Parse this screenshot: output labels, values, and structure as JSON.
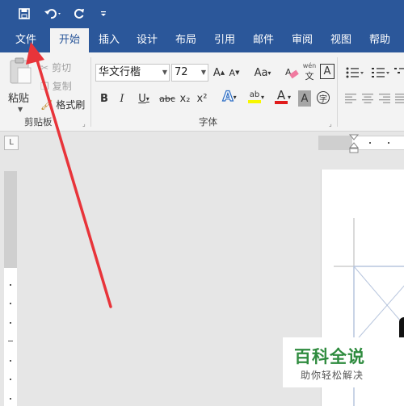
{
  "qat": {
    "save_icon": "save-icon",
    "undo_icon": "undo-icon",
    "redo_icon": "redo-icon",
    "customize_icon": "customize-qat-icon"
  },
  "tabs": [
    {
      "label": "文件"
    },
    {
      "label": "开始"
    },
    {
      "label": "插入"
    },
    {
      "label": "设计"
    },
    {
      "label": "布局"
    },
    {
      "label": "引用"
    },
    {
      "label": "邮件"
    },
    {
      "label": "审阅"
    },
    {
      "label": "视图"
    },
    {
      "label": "帮助"
    }
  ],
  "clipboard": {
    "paste_label": "粘贴",
    "cut_label": "剪切",
    "copy_label": "复制",
    "format_painter_label": "格式刷",
    "group_label": "剪贴板"
  },
  "font": {
    "font_name": "华文行楷",
    "font_size": "72",
    "group_label": "字体",
    "grow_label": "A",
    "shrink_label": "A",
    "case_label": "Aa",
    "phonetic_label": "wén",
    "charborder_label": "A",
    "bold_label": "B",
    "italic_label": "I",
    "underline_label": "U",
    "strike_label": "abc",
    "subscript_label": "x₂",
    "superscript_label": "x²",
    "effects_label": "A",
    "highlight_label": "ab",
    "color_label": "A",
    "shading_label": "A",
    "enclose_label": "字"
  },
  "ruler": {
    "tab_selector": "L"
  },
  "watermark": {
    "title": "百科全说",
    "subtitle": "助你轻松解决"
  },
  "colors": {
    "brand": "#2b579a",
    "annotation_arrow": "#e8343a",
    "watermark_green": "#2e8b3e"
  }
}
